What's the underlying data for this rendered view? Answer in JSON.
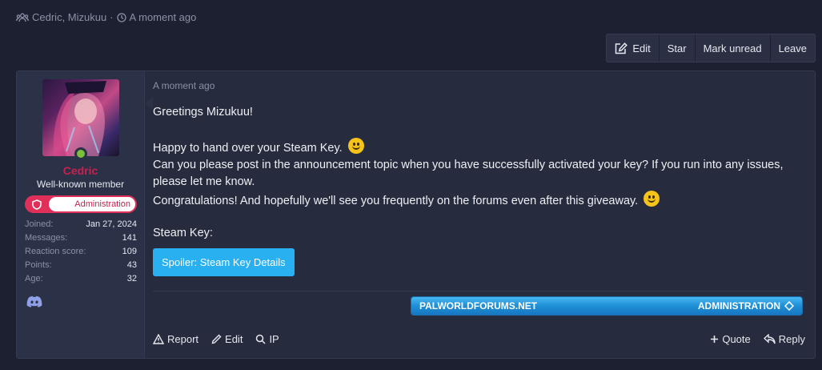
{
  "thread_meta": {
    "participants": "Cedric, Mizukuu",
    "separator": "·",
    "time": "A moment ago"
  },
  "toolbar": {
    "edit": "Edit",
    "star": "Star",
    "mark_unread": "Mark unread",
    "leave": "Leave"
  },
  "user": {
    "name": "Cedric",
    "title": "Well-known member",
    "role": "Administration",
    "stats": [
      {
        "label": "Joined:",
        "value": "Jan 27, 2024"
      },
      {
        "label": "Messages:",
        "value": "141"
      },
      {
        "label": "Reaction score:",
        "value": "109"
      },
      {
        "label": "Points:",
        "value": "43"
      },
      {
        "label": "Age:",
        "value": "32"
      }
    ]
  },
  "message": {
    "time": "A moment ago",
    "greeting": "Greetings Mizukuu!",
    "line1": "Happy to hand over your Steam Key.",
    "line2": "Can you please post in the announcement topic when you have successfully activated your key? If you run into any issues, please let me know.",
    "line3": "Congratulations! And hopefully we'll see you frequently on the forums even after this giveaway.",
    "steam_key_label": "Steam Key:",
    "spoiler_button": "Spoiler: Steam Key Details"
  },
  "banner": {
    "left": "PALWORLDFORUMS.NET",
    "right": "ADMINISTRATION"
  },
  "actions": {
    "report": "Report",
    "edit": "Edit",
    "ip": "IP",
    "quote": "Quote",
    "reply": "Reply"
  },
  "colors": {
    "background": "#1c2030",
    "username": "#c8214f",
    "role_badge": "#e0305a",
    "spoiler": "#29b0f0",
    "banner": "#1f8fd6",
    "online": "#7bbf3c"
  },
  "icons": {
    "participants": "users-icon",
    "time": "clock-icon",
    "edit": "edit-icon",
    "role": "shield-icon",
    "discord": "discord-icon",
    "banner": "diamond-icon",
    "report": "warning-icon",
    "edit_action": "pencil-icon",
    "ip": "search-icon",
    "quote": "plus-icon",
    "reply": "reply-icon"
  }
}
